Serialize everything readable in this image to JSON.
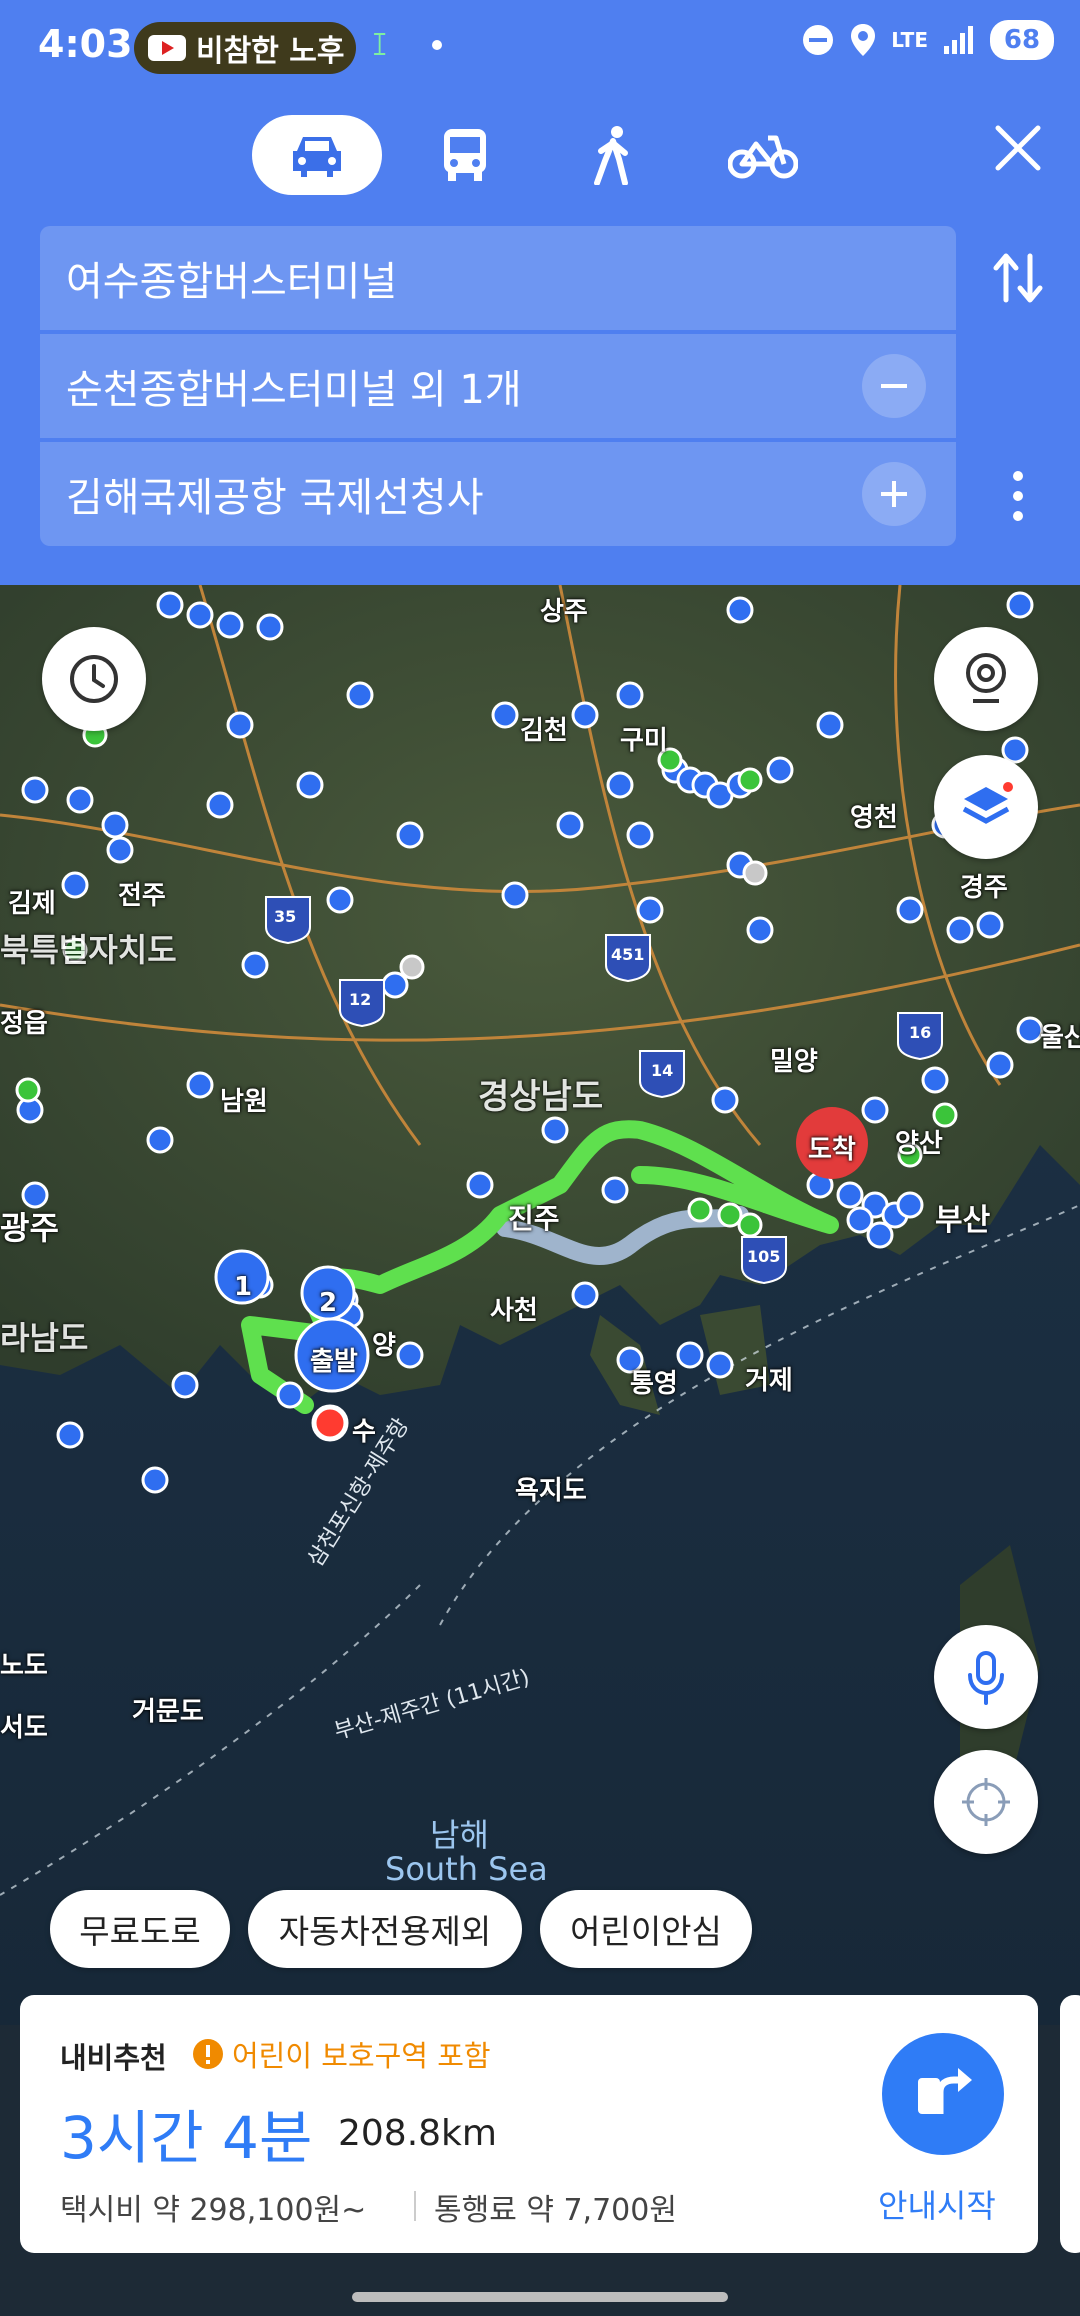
{
  "status_bar": {
    "time": "4:03",
    "notification": "비참한 노후",
    "network": "LTE",
    "battery": "68"
  },
  "modes": [
    {
      "name": "car",
      "active": true
    },
    {
      "name": "bus",
      "active": false
    },
    {
      "name": "walk",
      "active": false
    },
    {
      "name": "bike",
      "active": false
    }
  ],
  "route": {
    "origin": "여수종합버스터미널",
    "waypoint": "순천종합버스터미널 외 1개",
    "destination": "김해국제공항 국제선청사"
  },
  "map": {
    "labels": {
      "sangju": "상주",
      "gimcheon": "김천",
      "gumi": "구미",
      "yeongcheon": "영천",
      "gyeongju": "경주",
      "gimje": "김제",
      "jeonju": "전주",
      "jeonbuk": "북특별자치도",
      "jeongeup": "정읍",
      "namwon": "남원",
      "gyeongnam": "경상남도",
      "miryang": "밀양",
      "ulsan": "울산",
      "jinju": "진주",
      "busan": "부산",
      "yangsan": "양산",
      "sacheon": "사천",
      "tongyeong": "통영",
      "geoje": "거제",
      "jeonnam": "라남도",
      "gwangju": "광주",
      "yeosu": "수",
      "gwangyang": "양",
      "yokjido": "욕지도",
      "geomundo": "거문도",
      "seodo": "서도",
      "nodo": "노도",
      "ferry1": "삼천포신항-제주항",
      "ferry2": "부산-제주간 (11시간)",
      "south_sea_ko": "남해",
      "south_sea_en": "South Sea",
      "highway_35": "35",
      "highway_12": "12",
      "highway_451": "451",
      "highway_14": "14",
      "highway_16": "16",
      "highway_105": "105",
      "marker_1": "1",
      "marker_2": "2",
      "start": "출발",
      "end": "도착"
    }
  },
  "chips": [
    "무료도로",
    "자동차전용제외",
    "어린이안심"
  ],
  "card": {
    "tag": "내비추천",
    "warning": "어린이 보호구역 포함",
    "duration": "3시간 4분",
    "distance": "208.8km",
    "taxi": "택시비 약 298,100원~",
    "toll": "통행료 약 7,700원",
    "start_label": "안내시작"
  },
  "colors": {
    "header": "#4f7ff0",
    "accent": "#2f7cf6",
    "warning": "#f08a00",
    "route": "#5fe04e",
    "alt_route": "#9fb4cc",
    "poi": "#2f6ef0"
  }
}
